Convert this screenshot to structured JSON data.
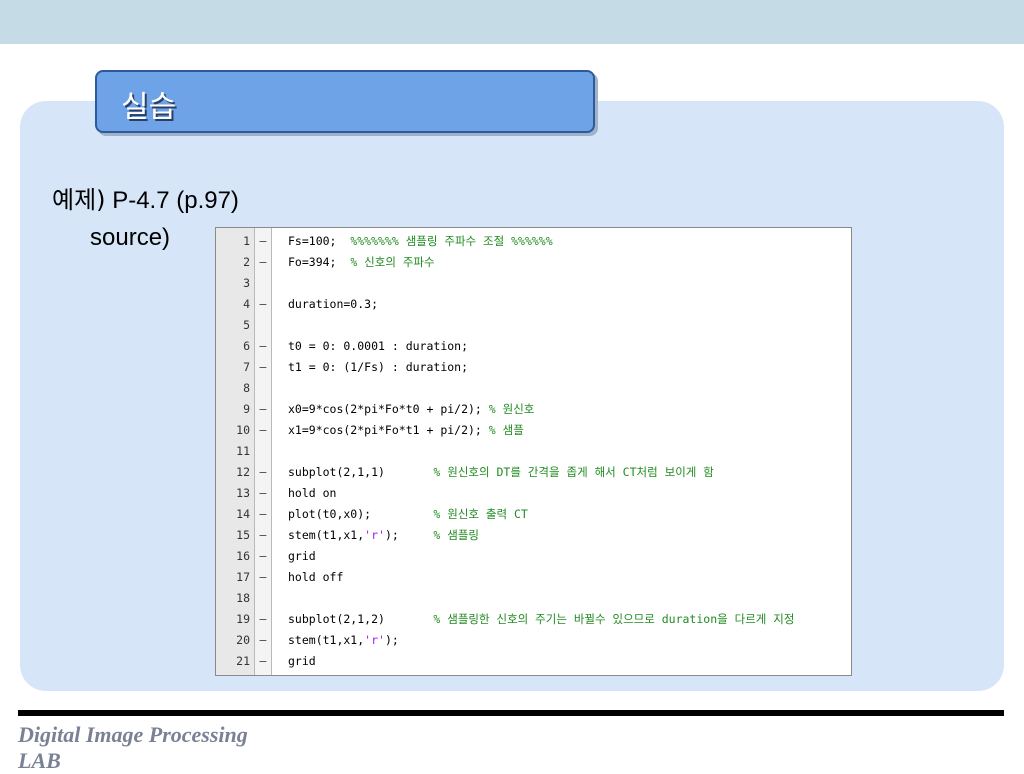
{
  "title": "실습",
  "heading": {
    "prefix": "예제)",
    "rest": " P-4.7 (p.97)"
  },
  "source_label": "source)",
  "editor": {
    "lines": [
      {
        "n": "1",
        "mark": "–",
        "code": "Fs=100;  ",
        "str": "",
        "code2": "",
        "comment": "%%%%%%% 샘플링 주파수 조절 %%%%%%"
      },
      {
        "n": "2",
        "mark": "–",
        "code": "Fo=394;  ",
        "str": "",
        "code2": "",
        "comment": "% 신호의 주파수"
      },
      {
        "n": "3",
        "mark": "",
        "code": "",
        "str": "",
        "code2": "",
        "comment": ""
      },
      {
        "n": "4",
        "mark": "–",
        "code": "duration=0.3;",
        "str": "",
        "code2": "",
        "comment": ""
      },
      {
        "n": "5",
        "mark": "",
        "code": "",
        "str": "",
        "code2": "",
        "comment": ""
      },
      {
        "n": "6",
        "mark": "–",
        "code": "t0 = 0: 0.0001 : duration;",
        "str": "",
        "code2": "",
        "comment": ""
      },
      {
        "n": "7",
        "mark": "–",
        "code": "t1 = 0: (1/Fs) : duration;",
        "str": "",
        "code2": "",
        "comment": ""
      },
      {
        "n": "8",
        "mark": "",
        "code": "",
        "str": "",
        "code2": "",
        "comment": ""
      },
      {
        "n": "9",
        "mark": "–",
        "code": "x0=9*cos(2*pi*Fo*t0 + pi/2); ",
        "str": "",
        "code2": "",
        "comment": "% 원신호"
      },
      {
        "n": "10",
        "mark": "–",
        "code": "x1=9*cos(2*pi*Fo*t1 + pi/2); ",
        "str": "",
        "code2": "",
        "comment": "% 샘플"
      },
      {
        "n": "11",
        "mark": "",
        "code": "",
        "str": "",
        "code2": "",
        "comment": ""
      },
      {
        "n": "12",
        "mark": "–",
        "code": "subplot(2,1,1)       ",
        "str": "",
        "code2": "",
        "comment": "% 원신호의 DT를 간격을 좁게 해서 CT처럼 보이게 함"
      },
      {
        "n": "13",
        "mark": "–",
        "code": "hold on",
        "str": "",
        "code2": "",
        "comment": ""
      },
      {
        "n": "14",
        "mark": "–",
        "code": "plot(t0,x0);         ",
        "str": "",
        "code2": "",
        "comment": "% 원신호 출력 CT"
      },
      {
        "n": "15",
        "mark": "–",
        "code": "stem(t1,x1,",
        "str": "'r'",
        "code2": ");     ",
        "comment": "% 샘플링"
      },
      {
        "n": "16",
        "mark": "–",
        "code": "grid",
        "str": "",
        "code2": "",
        "comment": ""
      },
      {
        "n": "17",
        "mark": "–",
        "code": "hold off",
        "str": "",
        "code2": "",
        "comment": ""
      },
      {
        "n": "18",
        "mark": "",
        "code": "",
        "str": "",
        "code2": "",
        "comment": ""
      },
      {
        "n": "19",
        "mark": "–",
        "code": "subplot(2,1,2)       ",
        "str": "",
        "code2": "",
        "comment": "% 샘플링한 신호의 주기는 바뀔수 있으므로 duration을 다르게 지정"
      },
      {
        "n": "20",
        "mark": "–",
        "code": "stem(t1,x1,",
        "str": "'r'",
        "code2": ");",
        "comment": ""
      },
      {
        "n": "21",
        "mark": "–",
        "code": "grid",
        "str": "",
        "code2": "",
        "comment": ""
      }
    ]
  },
  "footer": {
    "line1": "Digital Image Processing",
    "line2": "LAB"
  }
}
